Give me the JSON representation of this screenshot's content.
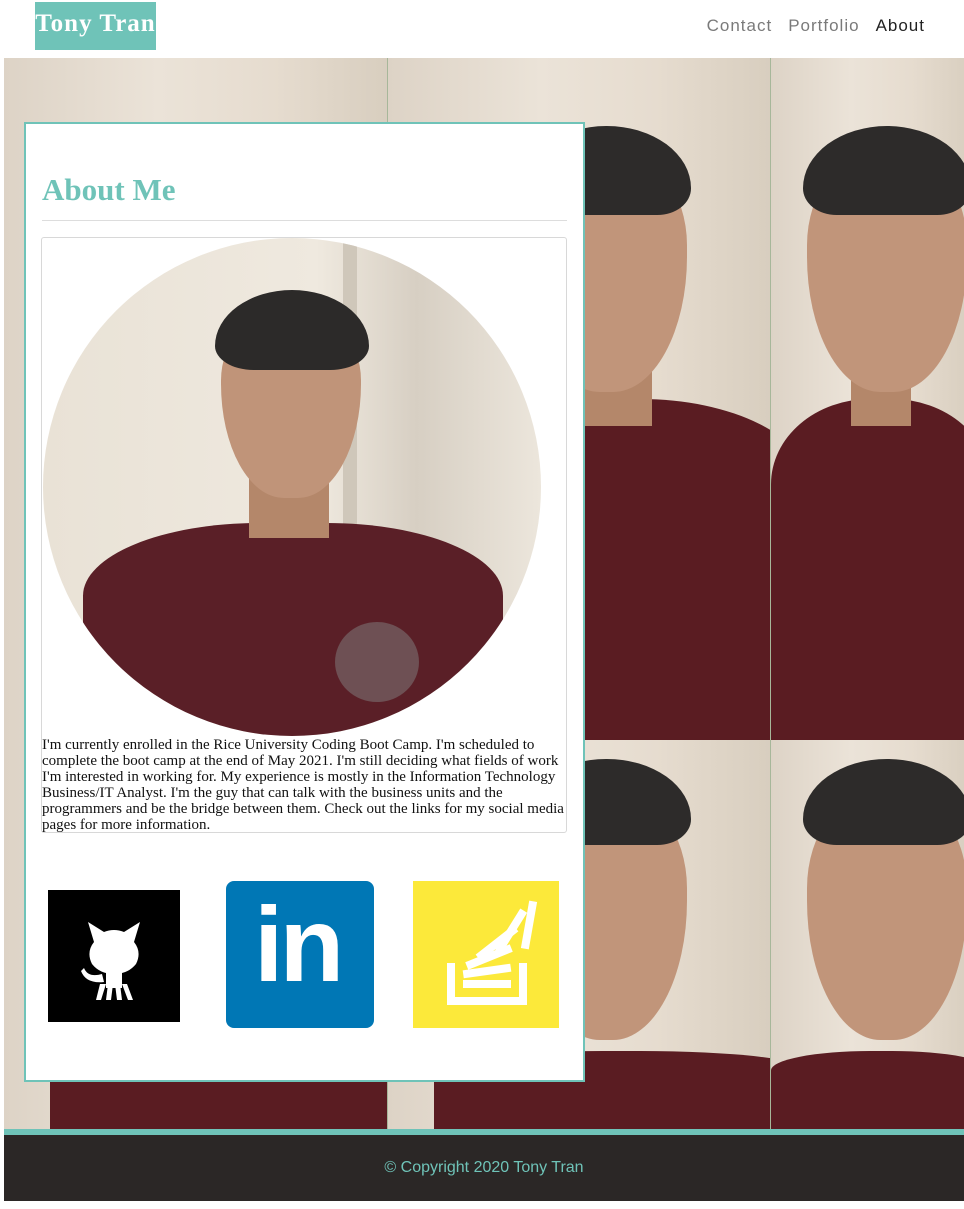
{
  "header": {
    "brand": "Tony Tran",
    "nav": [
      "Contact",
      "Portfolio",
      "About"
    ],
    "active_nav": "About"
  },
  "about": {
    "title": "About Me",
    "bio": "I'm currently enrolled in the Rice University Coding Boot Camp. I'm scheduled to complete the boot camp at the end of May 2021. I'm still deciding what fields of work I'm interested in working for. My experience is mostly in the Information Technology Business/IT Analyst. I'm the guy that can talk with the business units and the programmers and be the bridge between them. Check out the links for my social media pages for more information."
  },
  "social": {
    "links": [
      {
        "name": "GitHub",
        "icon": "github-icon"
      },
      {
        "name": "LinkedIn",
        "icon": "linkedin-icon",
        "glyph": "in"
      },
      {
        "name": "Stack Overflow",
        "icon": "stackoverflow-icon"
      }
    ]
  },
  "footer": {
    "copyright": "© Copyright 2020 Tony Tran"
  },
  "colors": {
    "accent": "#6fc3b8",
    "footer_bg": "#2b2726",
    "linkedin": "#0077b5",
    "stackoverflow_bg": "#fce93a",
    "github_bg": "#000000"
  }
}
